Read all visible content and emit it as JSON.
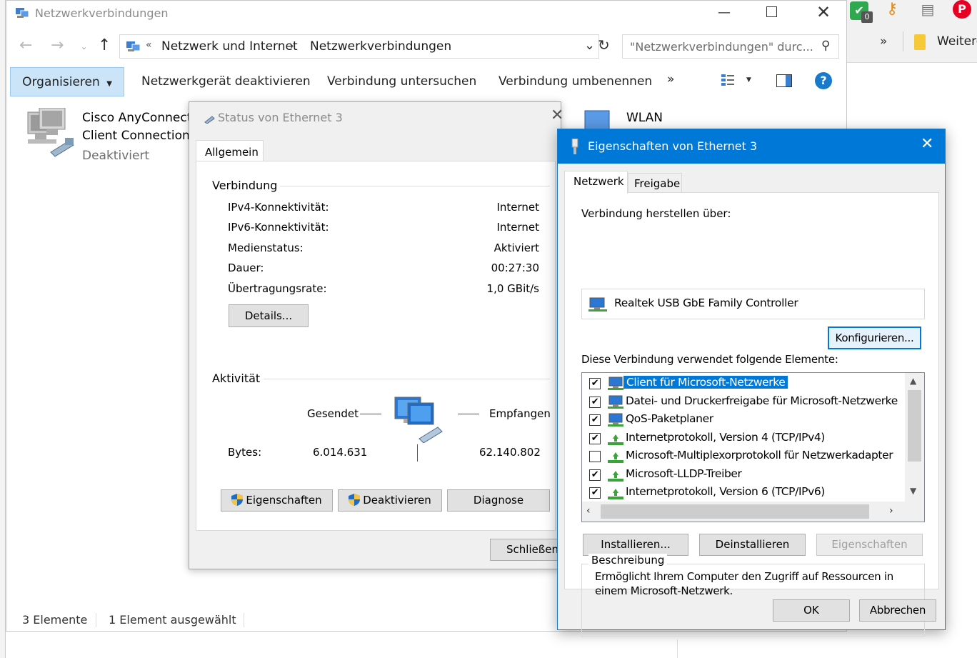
{
  "explorer": {
    "title": "Netzwerkverbindungen",
    "breadcrumb": [
      "Netzwerk und Internet",
      "Netzwerkverbindungen"
    ],
    "search_placeholder": "\"Netzwerkverbindungen\" durc...",
    "toolbar": {
      "organize": "Organisieren",
      "disable": "Netzwerkgerät deaktivieren",
      "diagnose": "Verbindung untersuchen",
      "rename": "Verbindung umbenennen",
      "more": "»"
    },
    "items": [
      {
        "name_line1": "Cisco AnyConnect S",
        "name_line2": "Client Connection",
        "status": "Deaktiviert"
      },
      {
        "name_line1": "WLAN"
      }
    ],
    "statusbar": {
      "count": "3 Elemente",
      "selected": "1 Element ausgewählt"
    }
  },
  "browser": {
    "bookmark_more": "»",
    "bookmark_folder": "Weitere",
    "badge_count": "0"
  },
  "status_dialog": {
    "title": "Status von Ethernet 3",
    "tab": "Allgemein",
    "connection_group": "Verbindung",
    "rows": [
      {
        "label": "IPv4-Konnektivität:",
        "value": "Internet"
      },
      {
        "label": "IPv6-Konnektivität:",
        "value": "Internet"
      },
      {
        "label": "Medienstatus:",
        "value": "Aktiviert"
      },
      {
        "label": "Dauer:",
        "value": "00:27:30"
      },
      {
        "label": "Übertragungsrate:",
        "value": "1,0 GBit/s"
      }
    ],
    "details_button": "Details...",
    "activity_group": "Aktivität",
    "sent_label": "Gesendet",
    "received_label": "Empfangen",
    "bytes_label": "Bytes:",
    "bytes_sent": "6.014.631",
    "bytes_received": "62.140.802",
    "properties_button": "Eigenschaften",
    "deactivate_button": "Deaktivieren",
    "diagnose_button": "Diagnose",
    "close_button": "Schließen"
  },
  "properties_dialog": {
    "title": "Eigenschaften von Ethernet 3",
    "tabs": [
      "Netzwerk",
      "Freigabe"
    ],
    "connect_using_label": "Verbindung herstellen über:",
    "adapter": "Realtek USB GbE Family Controller",
    "configure_button": "Konfigurieren...",
    "elements_label": "Diese Verbindung verwendet folgende Elemente:",
    "elements": [
      {
        "label": "Client für Microsoft-Netzwerke",
        "checked": true,
        "icon": "network-client-icon",
        "selected": true
      },
      {
        "label": "Datei- und Druckerfreigabe für Microsoft-Netzwerke",
        "checked": true,
        "icon": "network-client-icon",
        "selected": false
      },
      {
        "label": "QoS-Paketplaner",
        "checked": true,
        "icon": "network-client-icon",
        "selected": false
      },
      {
        "label": "Internetprotokoll, Version 4 (TCP/IPv4)",
        "checked": true,
        "icon": "protocol-icon",
        "selected": false
      },
      {
        "label": "Microsoft-Multiplexorprotokoll für Netzwerkadapter",
        "checked": false,
        "icon": "protocol-icon",
        "selected": false
      },
      {
        "label": "Microsoft-LLDP-Treiber",
        "checked": true,
        "icon": "protocol-icon",
        "selected": false
      },
      {
        "label": "Internetprotokoll, Version 6 (TCP/IPv6)",
        "checked": true,
        "icon": "protocol-icon",
        "selected": false
      }
    ],
    "install_button": "Installieren...",
    "uninstall_button": "Deinstallieren",
    "properties_button": "Eigenschaften",
    "description_group": "Beschreibung",
    "description_line1": "Ermöglicht Ihrem Computer den Zugriff auf Ressourcen in",
    "description_line2": "einem Microsoft-Netzwerk.",
    "ok_button": "OK",
    "cancel_button": "Abbrechen"
  },
  "colors": {
    "accent": "#0078d7",
    "toolbar_selected": "#cce4f7",
    "dialog_bg": "#f0f0f0"
  }
}
